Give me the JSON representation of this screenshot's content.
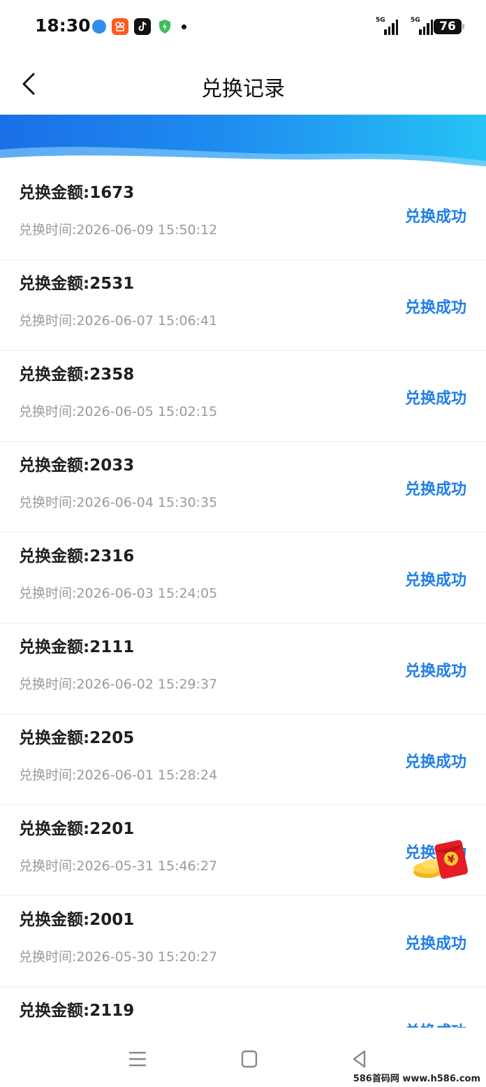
{
  "status_bar": {
    "time": "18:30",
    "network_1": "5G",
    "network_2": "5G",
    "battery": "76",
    "app_icons": [
      "blue-app-icon",
      "kuaishou-icon",
      "tiktok-icon",
      "shield-icon"
    ]
  },
  "header": {
    "title": "兑换记录"
  },
  "records": [
    {
      "amount": "兑换金额:1673",
      "time": "兑换时间:2026-06-09 15:50:12",
      "status": "兑换成功"
    },
    {
      "amount": "兑换金额:2531",
      "time": "兑换时间:2026-06-07 15:06:41",
      "status": "兑换成功"
    },
    {
      "amount": "兑换金额:2358",
      "time": "兑换时间:2026-06-05 15:02:15",
      "status": "兑换成功"
    },
    {
      "amount": "兑换金额:2033",
      "time": "兑换时间:2026-06-04 15:30:35",
      "status": "兑换成功"
    },
    {
      "amount": "兑换金额:2316",
      "time": "兑换时间:2026-06-03 15:24:05",
      "status": "兑换成功"
    },
    {
      "amount": "兑换金额:2111",
      "time": "兑换时间:2026-06-02 15:29:37",
      "status": "兑换成功"
    },
    {
      "amount": "兑换金额:2205",
      "time": "兑换时间:2026-06-01 15:28:24",
      "status": "兑换成功"
    },
    {
      "amount": "兑换金额:2201",
      "time": "兑换时间:2026-05-31 15:46:27",
      "status": "兑换成功"
    },
    {
      "amount": "兑换金额:2001",
      "time": "兑换时间:2026-05-30 15:20:27",
      "status": "兑换成功"
    },
    {
      "amount": "兑换金额:2119",
      "time": "",
      "status": "兑换成功"
    }
  ],
  "red_packet": {
    "symbol": "¥"
  },
  "watermark": "586首码网 www.h586.com",
  "colors": {
    "accent": "#1f7ee8",
    "banner_start": "#1a6fe6",
    "banner_end": "#27c3f5",
    "time_text": "#9a9a9a"
  }
}
